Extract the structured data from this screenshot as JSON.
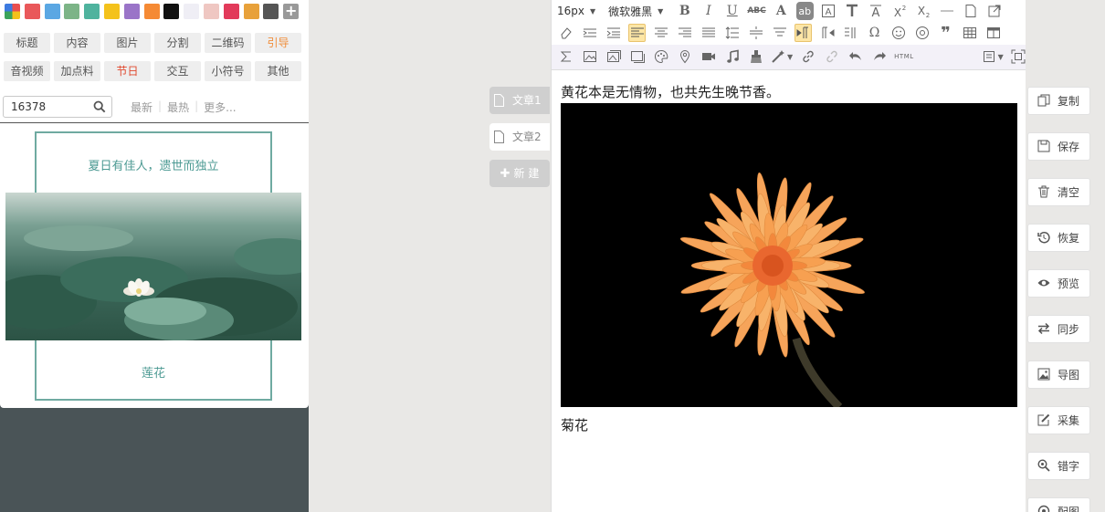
{
  "colors": {
    "swatches": [
      "#e9585a",
      "#5ba7e3",
      "#7cb487",
      "#4fb39e",
      "#f4c21b",
      "#9a74c8",
      "#f58a34",
      "#111111",
      "#efeef5",
      "#efc7c2",
      "#e23a5a",
      "#e8a13a",
      "#555555"
    ],
    "accent_teal": "#4c9a93",
    "accent_orange": "#f08d3a",
    "accent_red": "#e0492f"
  },
  "categories": {
    "row1": [
      "标题",
      "内容",
      "图片",
      "分割",
      "二维码",
      "引导"
    ],
    "row2": [
      "音视频",
      "加点料",
      "节日",
      "交互",
      "小符号",
      "其他"
    ]
  },
  "search": {
    "value": "16378",
    "links": [
      "最新",
      "最热",
      "更多..."
    ]
  },
  "preview": {
    "title": "夏日有佳人，遗世而独立",
    "caption": "莲花"
  },
  "articles": {
    "tabs": [
      "文章1",
      "文章2"
    ],
    "new_label": "新 建"
  },
  "toolbar": {
    "font_size": "16px",
    "font_family": "微软雅黑",
    "bold": "B",
    "italic": "I",
    "underline": "U",
    "strike": "ABC",
    "font_color": "A",
    "highlight": "ab",
    "omega": "Ω",
    "quote": "❞",
    "html": "HTML"
  },
  "editor": {
    "line1": "黄花本是无情物，也共先生晚节香。",
    "line2": "菊花"
  },
  "side_buttons": [
    "复制",
    "保存",
    "清空",
    "恢复",
    "预览",
    "同步",
    "导图",
    "采集",
    "错字",
    "配图"
  ]
}
